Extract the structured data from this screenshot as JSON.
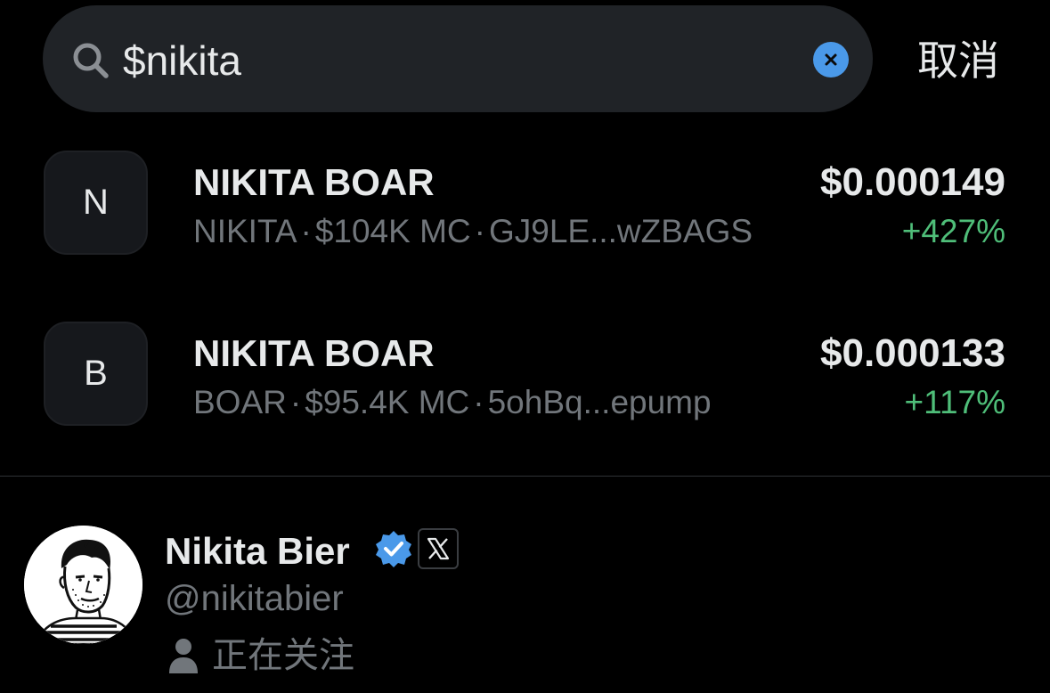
{
  "search": {
    "query": "$nikita",
    "cancel_label": "取消",
    "icon": "search-icon",
    "clear_icon": "clear-x-icon",
    "accent_color": "#4a99e9"
  },
  "tokens": [
    {
      "avatar_letter": "N",
      "name": "NIKITA BOAR",
      "symbol": "NIKITA",
      "market_cap": "$104K MC",
      "address": "GJ9LE...wZBAGS",
      "price": "$0.000149",
      "change": "+427%"
    },
    {
      "avatar_letter": "B",
      "name": "NIKITA BOAR",
      "symbol": "BOAR",
      "market_cap": "$95.4K MC",
      "address": "5ohBq...epump",
      "price": "$0.000133",
      "change": "+117%"
    }
  ],
  "separator": "·",
  "user": {
    "display_name": "Nikita Bier",
    "handle": "@nikitabier",
    "follow_status": "正在关注",
    "verified_icon": "verified-badge-icon",
    "affiliate_icon": "x-logo-icon",
    "verified_color": "#4a99e9"
  },
  "colors": {
    "background": "#000000",
    "positive_change": "#4fbe79",
    "secondary_text": "#71767b"
  }
}
